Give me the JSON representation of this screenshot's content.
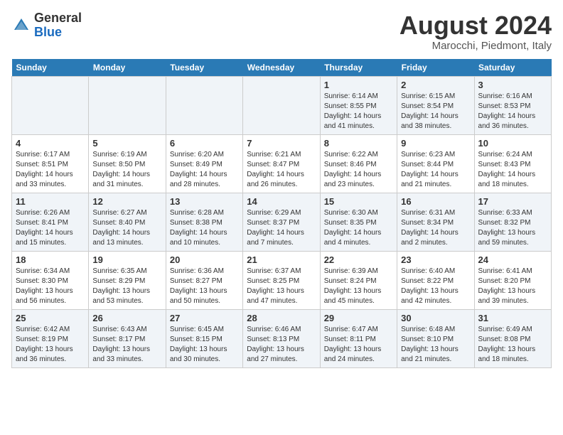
{
  "header": {
    "logo_line1": "General",
    "logo_line2": "Blue",
    "month_year": "August 2024",
    "location": "Marocchi, Piedmont, Italy"
  },
  "days_of_week": [
    "Sunday",
    "Monday",
    "Tuesday",
    "Wednesday",
    "Thursday",
    "Friday",
    "Saturday"
  ],
  "weeks": [
    [
      {
        "day": "",
        "info": ""
      },
      {
        "day": "",
        "info": ""
      },
      {
        "day": "",
        "info": ""
      },
      {
        "day": "",
        "info": ""
      },
      {
        "day": "1",
        "info": "Sunrise: 6:14 AM\nSunset: 8:55 PM\nDaylight: 14 hours\nand 41 minutes."
      },
      {
        "day": "2",
        "info": "Sunrise: 6:15 AM\nSunset: 8:54 PM\nDaylight: 14 hours\nand 38 minutes."
      },
      {
        "day": "3",
        "info": "Sunrise: 6:16 AM\nSunset: 8:53 PM\nDaylight: 14 hours\nand 36 minutes."
      }
    ],
    [
      {
        "day": "4",
        "info": "Sunrise: 6:17 AM\nSunset: 8:51 PM\nDaylight: 14 hours\nand 33 minutes."
      },
      {
        "day": "5",
        "info": "Sunrise: 6:19 AM\nSunset: 8:50 PM\nDaylight: 14 hours\nand 31 minutes."
      },
      {
        "day": "6",
        "info": "Sunrise: 6:20 AM\nSunset: 8:49 PM\nDaylight: 14 hours\nand 28 minutes."
      },
      {
        "day": "7",
        "info": "Sunrise: 6:21 AM\nSunset: 8:47 PM\nDaylight: 14 hours\nand 26 minutes."
      },
      {
        "day": "8",
        "info": "Sunrise: 6:22 AM\nSunset: 8:46 PM\nDaylight: 14 hours\nand 23 minutes."
      },
      {
        "day": "9",
        "info": "Sunrise: 6:23 AM\nSunset: 8:44 PM\nDaylight: 14 hours\nand 21 minutes."
      },
      {
        "day": "10",
        "info": "Sunrise: 6:24 AM\nSunset: 8:43 PM\nDaylight: 14 hours\nand 18 minutes."
      }
    ],
    [
      {
        "day": "11",
        "info": "Sunrise: 6:26 AM\nSunset: 8:41 PM\nDaylight: 14 hours\nand 15 minutes."
      },
      {
        "day": "12",
        "info": "Sunrise: 6:27 AM\nSunset: 8:40 PM\nDaylight: 14 hours\nand 13 minutes."
      },
      {
        "day": "13",
        "info": "Sunrise: 6:28 AM\nSunset: 8:38 PM\nDaylight: 14 hours\nand 10 minutes."
      },
      {
        "day": "14",
        "info": "Sunrise: 6:29 AM\nSunset: 8:37 PM\nDaylight: 14 hours\nand 7 minutes."
      },
      {
        "day": "15",
        "info": "Sunrise: 6:30 AM\nSunset: 8:35 PM\nDaylight: 14 hours\nand 4 minutes."
      },
      {
        "day": "16",
        "info": "Sunrise: 6:31 AM\nSunset: 8:34 PM\nDaylight: 14 hours\nand 2 minutes."
      },
      {
        "day": "17",
        "info": "Sunrise: 6:33 AM\nSunset: 8:32 PM\nDaylight: 13 hours\nand 59 minutes."
      }
    ],
    [
      {
        "day": "18",
        "info": "Sunrise: 6:34 AM\nSunset: 8:30 PM\nDaylight: 13 hours\nand 56 minutes."
      },
      {
        "day": "19",
        "info": "Sunrise: 6:35 AM\nSunset: 8:29 PM\nDaylight: 13 hours\nand 53 minutes."
      },
      {
        "day": "20",
        "info": "Sunrise: 6:36 AM\nSunset: 8:27 PM\nDaylight: 13 hours\nand 50 minutes."
      },
      {
        "day": "21",
        "info": "Sunrise: 6:37 AM\nSunset: 8:25 PM\nDaylight: 13 hours\nand 47 minutes."
      },
      {
        "day": "22",
        "info": "Sunrise: 6:39 AM\nSunset: 8:24 PM\nDaylight: 13 hours\nand 45 minutes."
      },
      {
        "day": "23",
        "info": "Sunrise: 6:40 AM\nSunset: 8:22 PM\nDaylight: 13 hours\nand 42 minutes."
      },
      {
        "day": "24",
        "info": "Sunrise: 6:41 AM\nSunset: 8:20 PM\nDaylight: 13 hours\nand 39 minutes."
      }
    ],
    [
      {
        "day": "25",
        "info": "Sunrise: 6:42 AM\nSunset: 8:19 PM\nDaylight: 13 hours\nand 36 minutes."
      },
      {
        "day": "26",
        "info": "Sunrise: 6:43 AM\nSunset: 8:17 PM\nDaylight: 13 hours\nand 33 minutes."
      },
      {
        "day": "27",
        "info": "Sunrise: 6:45 AM\nSunset: 8:15 PM\nDaylight: 13 hours\nand 30 minutes."
      },
      {
        "day": "28",
        "info": "Sunrise: 6:46 AM\nSunset: 8:13 PM\nDaylight: 13 hours\nand 27 minutes."
      },
      {
        "day": "29",
        "info": "Sunrise: 6:47 AM\nSunset: 8:11 PM\nDaylight: 13 hours\nand 24 minutes."
      },
      {
        "day": "30",
        "info": "Sunrise: 6:48 AM\nSunset: 8:10 PM\nDaylight: 13 hours\nand 21 minutes."
      },
      {
        "day": "31",
        "info": "Sunrise: 6:49 AM\nSunset: 8:08 PM\nDaylight: 13 hours\nand 18 minutes."
      }
    ]
  ]
}
